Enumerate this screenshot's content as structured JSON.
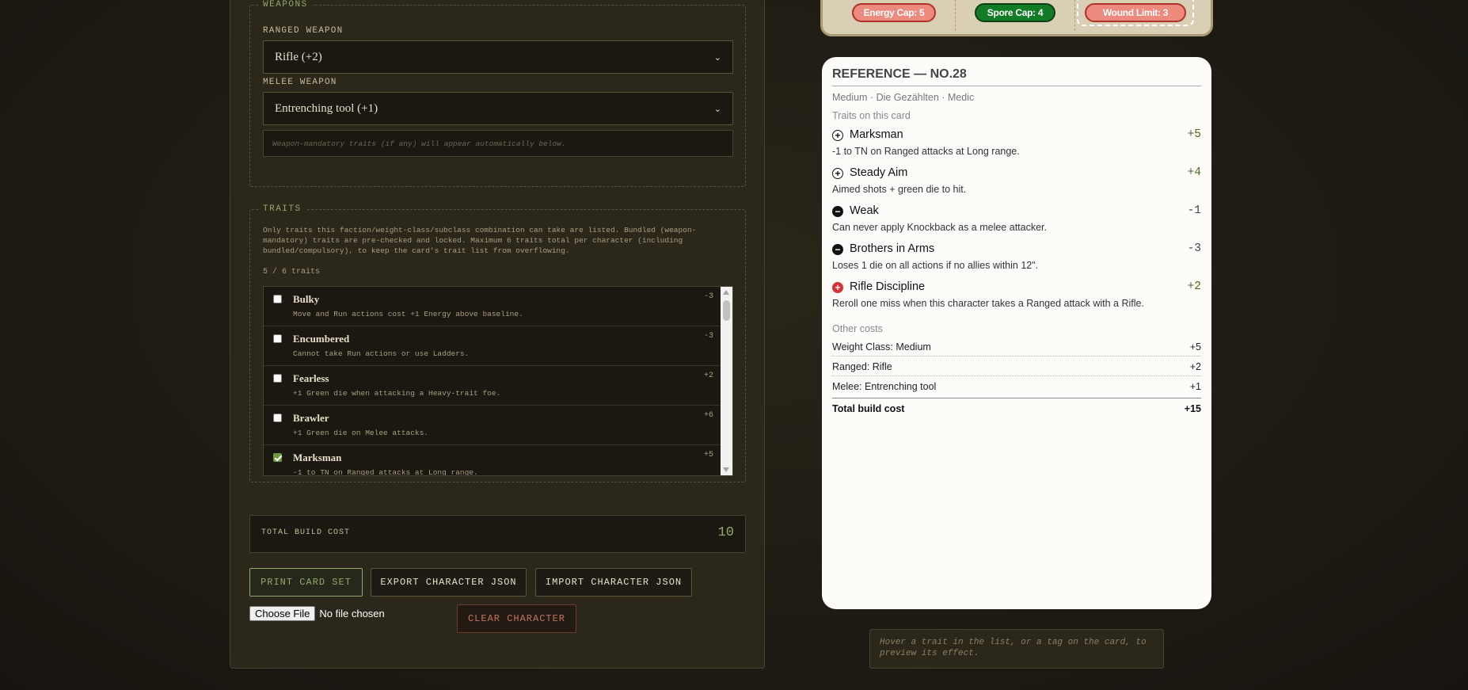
{
  "weapons": {
    "legend": "WEAPONS",
    "ranged_label": "RANGED WEAPON",
    "ranged_value": "Rifle (+2)",
    "melee_label": "MELEE WEAPON",
    "melee_value": "Entrenching tool (+1)",
    "hint": "Weapon-mandatory traits (if any) will appear automatically below."
  },
  "traits": {
    "legend": "TRAITS",
    "description": "Only traits this faction/weight-class/subclass combination can take are listed. Bundled (weapon-mandatory) traits are pre-checked and locked. Maximum 6 traits total per character (including bundled/compulsory), to keep the card's trait list from overflowing.",
    "count": "5 / 6 traits",
    "items": [
      {
        "name": "Bulky",
        "desc": "Move and Run actions cost +1 Energy above baseline.",
        "cost": "-3",
        "checked": false
      },
      {
        "name": "Encumbered",
        "desc": "Cannot take Run actions or use Ladders.",
        "cost": "-3",
        "checked": false
      },
      {
        "name": "Fearless",
        "desc": "+1 Green die when attacking a Heavy-trait foe.",
        "cost": "+2",
        "checked": false
      },
      {
        "name": "Brawler",
        "desc": "+1 Green die on Melee attacks.",
        "cost": "+6",
        "checked": false
      },
      {
        "name": "Marksman",
        "desc": "-1 to TN on Ranged attacks at Long range.",
        "cost": "+5",
        "checked": true
      }
    ]
  },
  "total": {
    "label": "TOTAL BUILD COST",
    "value": "10"
  },
  "buttons": {
    "print": "PRINT CARD SET",
    "export": "EXPORT CHARACTER JSON",
    "import": "IMPORT CHARACTER JSON",
    "choose_file": "Choose File",
    "no_file": "No file chosen",
    "clear": "CLEAR CHARACTER"
  },
  "card_top": {
    "energy": "Energy Cap: 5",
    "spore": "Spore Cap: 4",
    "wound": "Wound Limit: 3"
  },
  "reference": {
    "title": "REFERENCE — NO.28",
    "subtitle": "Medium · Die Gezählten · Medic",
    "traits_heading": "Traits on this card",
    "traits": [
      {
        "name": "Marksman",
        "desc": "-1 to TN on Ranged attacks at Long range.",
        "cost": "+5",
        "icon": "plus"
      },
      {
        "name": "Steady Aim",
        "desc": "Aimed shots + green die to hit.",
        "cost": "+4",
        "icon": "plus"
      },
      {
        "name": "Weak",
        "desc": "Can never apply Knockback as a melee attacker.",
        "cost": "-1",
        "icon": "minus"
      },
      {
        "name": "Brothers in Arms",
        "desc": "Loses 1 die on all actions if no allies within 12\".",
        "cost": "-3",
        "icon": "minus"
      },
      {
        "name": "Rifle Discipline",
        "desc": "Reroll one miss when this character takes a Ranged attack with a Rifle.",
        "cost": "+2",
        "icon": "red-plus"
      }
    ],
    "other_heading": "Other costs",
    "other_costs": [
      {
        "label": "Weight Class: Medium",
        "value": "+5"
      },
      {
        "label": "Ranged: Rifle",
        "value": "+2"
      },
      {
        "label": "Melee: Entrenching tool",
        "value": "+1"
      }
    ],
    "total_label": "Total build cost",
    "total_value": "+15"
  },
  "hover_hint": "Hover a trait in the list, or a tag on the card, to preview its effect."
}
